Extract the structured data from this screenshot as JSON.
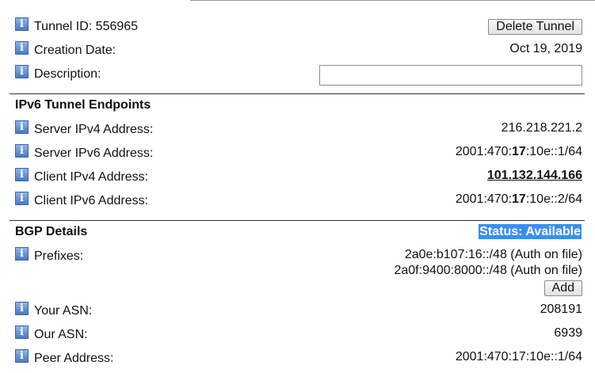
{
  "tunnel": {
    "id_label": "Tunnel ID: 556965",
    "delete_button": "Delete Tunnel",
    "creation_label": "Creation Date:",
    "creation_value": "Oct 19, 2019",
    "description_label": "Description:",
    "description_value": ""
  },
  "endpoints": {
    "title": "IPv6 Tunnel Endpoints",
    "server_ipv4_label": "Server IPv4 Address:",
    "server_ipv4_value": "216.218.221.2",
    "server_ipv6_label": "Server IPv6 Address:",
    "server_ipv6_prefix": "2001:470:",
    "server_ipv6_bold": "17",
    "server_ipv6_suffix": ":10e::1/64",
    "client_ipv4_label": "Client IPv4 Address:",
    "client_ipv4_value": "101.132.144.166",
    "client_ipv6_label": "Client IPv6 Address:",
    "client_ipv6_prefix": "2001:470:",
    "client_ipv6_bold": "17",
    "client_ipv6_suffix": ":10e::2/64"
  },
  "bgp": {
    "title": "BGP Details",
    "status": "Status: Available",
    "prefixes_label": "Prefixes:",
    "prefix_1": "2a0e:b107:16::/48 (Auth on file)",
    "prefix_2": "2a0f:9400:8000::/48 (Auth on file)",
    "add_button": "Add",
    "your_asn_label": "Your ASN:",
    "your_asn_value": "208191",
    "our_asn_label": "Our ASN:",
    "our_asn_value": "6939",
    "peer_label": "Peer Address:",
    "peer_value": "2001:470:17:10e::1/64"
  },
  "icons": {
    "info": "info-icon"
  },
  "info_glyph": "i",
  "colors": {
    "status_bg": "#3a8ef0",
    "info_icon": "#4b78c4"
  }
}
